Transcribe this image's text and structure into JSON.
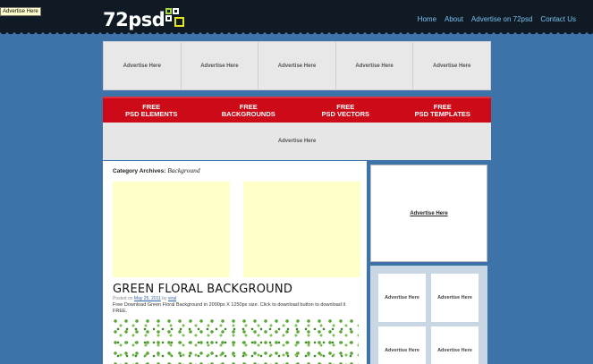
{
  "tooltip": "Advertise Here",
  "header": {
    "logo_text": "72psd",
    "nav": [
      {
        "label": "Home"
      },
      {
        "label": "About"
      },
      {
        "label": "Advertise on 72psd"
      },
      {
        "label": "Contact Us"
      }
    ]
  },
  "ad_row": [
    "Advertise Here",
    "Advertise Here",
    "Advertise Here",
    "Advertise Here",
    "Advertise Here"
  ],
  "red_bar": [
    {
      "line1": "FREE",
      "line2": "PSD ELEMENTS"
    },
    {
      "line1": "FREE",
      "line2": "BACKGROUNDS"
    },
    {
      "line1": "FREE",
      "line2": "PSD VECTORS"
    },
    {
      "line1": "FREE",
      "line2": "PSD TEMPLATES"
    }
  ],
  "banner": "Advertise Here",
  "main": {
    "category_prefix": "Category Archives:",
    "category_name": "Background",
    "post": {
      "title": "GREEN FLORAL BACKGROUND",
      "posted_on": "Posted on",
      "date": "May 25, 2011",
      "by": "by",
      "author": "viral",
      "description": "Free Download Green Floral Background in 2000px X 1250px size. Click to download button to download it FREE."
    }
  },
  "sidebar": {
    "big_ad": "Advertise Here",
    "small_ads": [
      "Advertise Here",
      "Advertise Here",
      "Advertise Here",
      "Advertise Here"
    ]
  },
  "colors": {
    "background": "#3d73a8",
    "header": "#0f1a24",
    "nav_link": "#7ac0f0",
    "red_bar": "#cc0a18",
    "logo_accent": "#a5d63a"
  }
}
